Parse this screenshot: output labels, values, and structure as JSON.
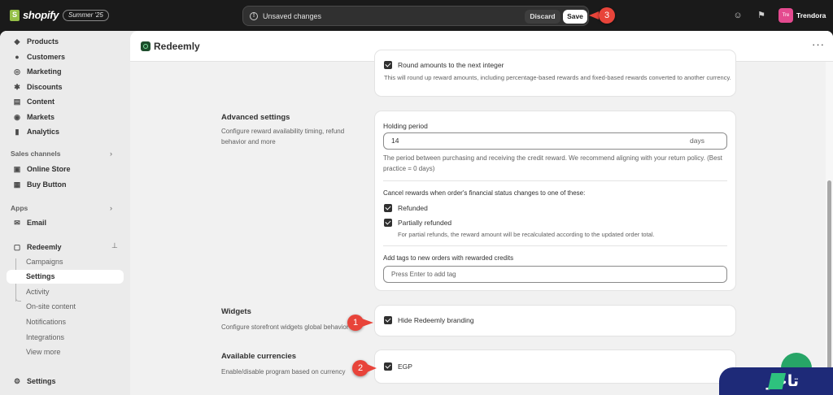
{
  "topbar": {
    "logo_text": "shopify",
    "edition": "Summer '25",
    "unsaved_label": "Unsaved changes",
    "discard_label": "Discard",
    "save_label": "Save",
    "store_initials": "Tre",
    "store_name": "Trendora"
  },
  "annotations": [
    "1",
    "2",
    "3"
  ],
  "sidebar": {
    "main_items": [
      {
        "label": "Products",
        "icon": "tag-icon"
      },
      {
        "label": "Customers",
        "icon": "person-icon"
      },
      {
        "label": "Marketing",
        "icon": "target-icon"
      },
      {
        "label": "Discounts",
        "icon": "discount-icon"
      },
      {
        "label": "Content",
        "icon": "content-icon"
      },
      {
        "label": "Markets",
        "icon": "globe-icon"
      },
      {
        "label": "Analytics",
        "icon": "bar-chart-icon"
      }
    ],
    "sales_channels_title": "Sales channels",
    "sales_channels": [
      {
        "label": "Online Store",
        "icon": "store-icon"
      },
      {
        "label": "Buy Button",
        "icon": "buy-button-icon"
      }
    ],
    "apps_title": "Apps",
    "apps": [
      {
        "label": "Email",
        "icon": "email-icon"
      }
    ],
    "app_name": "Redeemly",
    "app_subitems": [
      "Campaigns",
      "Settings",
      "Activity",
      "On-site content",
      "Notifications",
      "Integrations",
      "View more"
    ],
    "active_subitem": "Settings",
    "settings_label": "Settings"
  },
  "app": {
    "title": "Redeemly"
  },
  "rounding": {
    "checkbox_label": "Round amounts to the next integer",
    "checked": true,
    "help": "This will round up reward amounts, including percentage-based rewards and fixed-based rewards converted to another currency."
  },
  "advanced": {
    "title": "Advanced settings",
    "description": "Configure reward availability timing, refund behavior and more",
    "holding_label": "Holding period",
    "holding_value": "14",
    "holding_suffix": "days",
    "holding_help": "The period between purchasing and receiving the credit reward. We recommend aligning with your return policy. (Best practice = 0 days)",
    "cancel_label": "Cancel rewards when order's financial status changes to one of these:",
    "refunded_label": "Refunded",
    "refunded_checked": true,
    "partial_label": "Partially refunded",
    "partial_checked": true,
    "partial_help": "For partial refunds, the reward amount will be recalculated according to the updated order total.",
    "tags_label": "Add tags to new orders with rewarded credits",
    "tags_placeholder": "Press Enter to add tag"
  },
  "widgets": {
    "title": "Widgets",
    "description": "Configure storefront widgets global behavior",
    "branding_label": "Hide Redeemly branding",
    "branding_checked": true
  },
  "currencies": {
    "title": "Available currencies",
    "description": "Enable/disable program based on currency",
    "egp_label": "EGP",
    "egp_checked": true
  },
  "watermark": {
    "text": "تاجر"
  }
}
